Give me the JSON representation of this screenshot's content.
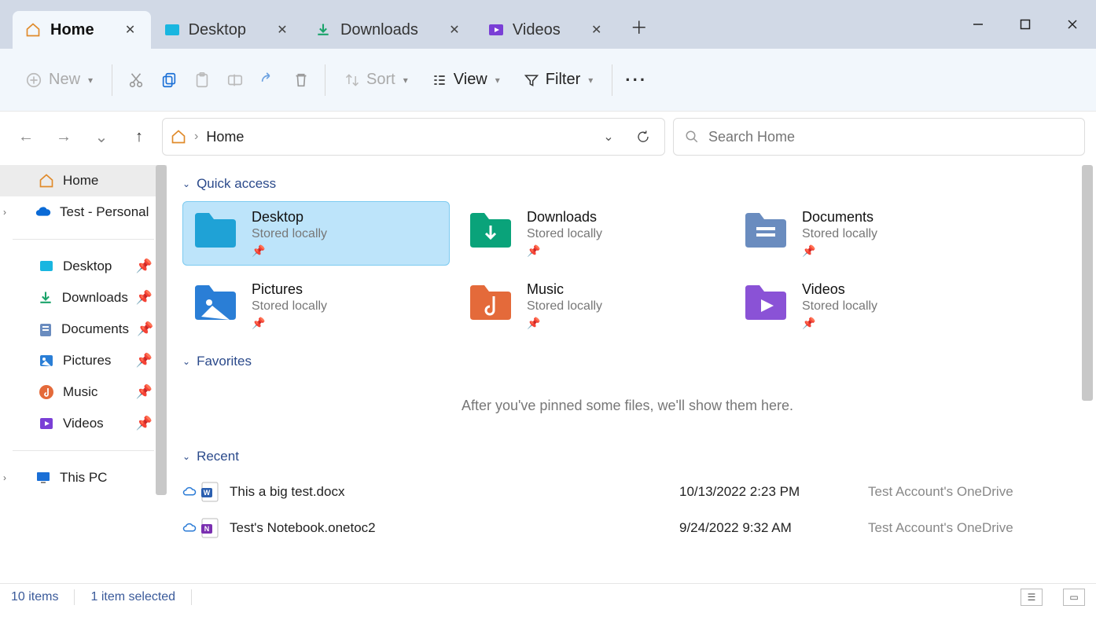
{
  "tabs": [
    {
      "label": "Home",
      "icon": "home-icon"
    },
    {
      "label": "Desktop",
      "icon": "desktop-icon"
    },
    {
      "label": "Downloads",
      "icon": "download-icon"
    },
    {
      "label": "Videos",
      "icon": "videos-icon"
    }
  ],
  "toolbar": {
    "new_label": "New",
    "sort_label": "Sort",
    "view_label": "View",
    "filter_label": "Filter"
  },
  "nav": {
    "breadcrumb": "Home"
  },
  "search": {
    "placeholder": "Search Home"
  },
  "sidebar": {
    "home": "Home",
    "onedrive": "Test - Personal",
    "items": [
      {
        "label": "Desktop"
      },
      {
        "label": "Downloads"
      },
      {
        "label": "Documents"
      },
      {
        "label": "Pictures"
      },
      {
        "label": "Music"
      },
      {
        "label": "Videos"
      }
    ],
    "thispc": "This PC"
  },
  "sections": {
    "quick_access": "Quick access",
    "favorites": "Favorites",
    "recent": "Recent"
  },
  "quick_access": [
    {
      "name": "Desktop",
      "sub": "Stored locally",
      "color": "#1fa2d6"
    },
    {
      "name": "Downloads",
      "sub": "Stored locally",
      "color": "#0aa37a"
    },
    {
      "name": "Documents",
      "sub": "Stored locally",
      "color": "#6a8cbf"
    },
    {
      "name": "Pictures",
      "sub": "Stored locally",
      "color": "#2a7ed6"
    },
    {
      "name": "Music",
      "sub": "Stored locally",
      "color": "#e46a3a"
    },
    {
      "name": "Videos",
      "sub": "Stored locally",
      "color": "#8a52d6"
    }
  ],
  "favorites_empty": "After you've pinned some files, we'll show them here.",
  "recent": [
    {
      "name": "This a big test.docx",
      "date": "10/13/2022 2:23 PM",
      "loc": "Test Account's OneDrive",
      "app": "word"
    },
    {
      "name": "Test's Notebook.onetoc2",
      "date": "9/24/2022 9:32 AM",
      "loc": "Test Account's OneDrive",
      "app": "onenote"
    }
  ],
  "status": {
    "items": "10 items",
    "selected": "1 item selected"
  }
}
